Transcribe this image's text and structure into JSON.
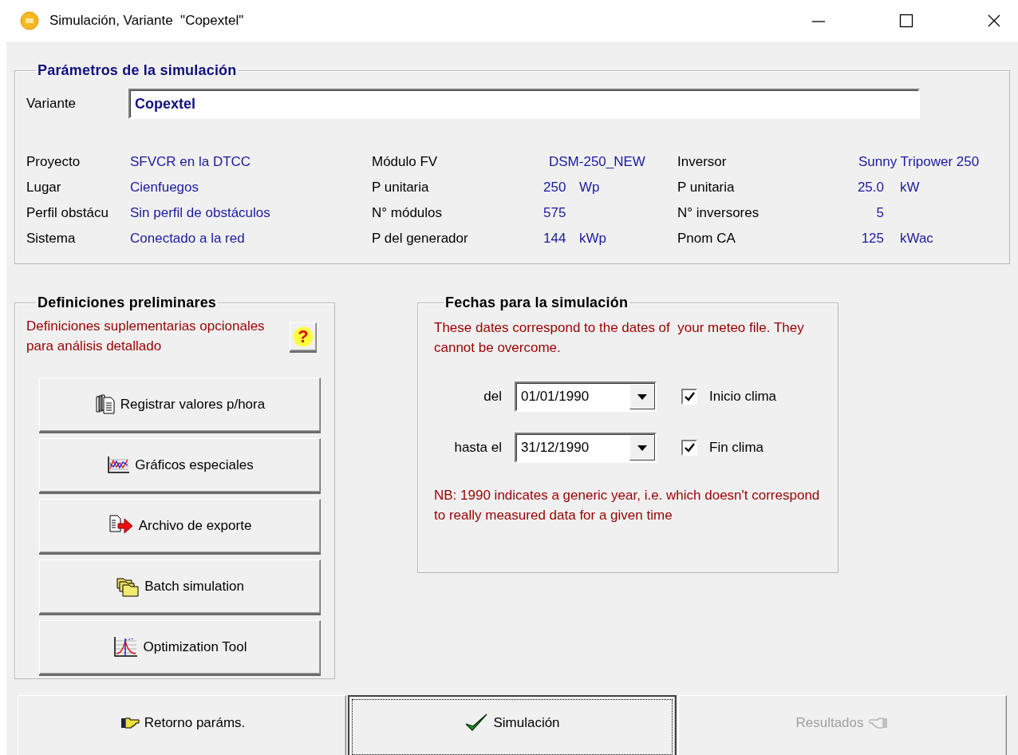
{
  "window": {
    "title": "Simulación, Variante  \"Copextel\""
  },
  "parameters": {
    "title": "Parámetros de la simulación",
    "variant": {
      "label": "Variante",
      "value": "Copextel"
    },
    "columns": [
      {
        "items": [
          {
            "label": "Proyecto",
            "kind": "text",
            "value": "SFVCR en la DTCC"
          },
          {
            "label": "Lugar",
            "kind": "text",
            "value": "Cienfuegos"
          },
          {
            "label": "Perfil obstácu",
            "kind": "text",
            "value": "Sin perfil de obstáculos"
          },
          {
            "label": "Sistema",
            "kind": "text",
            "value": "Conectado a la red"
          }
        ]
      },
      {
        "items": [
          {
            "label": "Módulo FV",
            "kind": "text",
            "value": "DSM-250_NEW"
          },
          {
            "label": "P unitaria",
            "kind": "quantity",
            "value": "250",
            "unit": "Wp"
          },
          {
            "label": "N° módulos",
            "kind": "quantity",
            "value": "575"
          },
          {
            "label": "P del generador",
            "kind": "quantity",
            "value": "144",
            "unit": "kWp"
          }
        ]
      },
      {
        "items": [
          {
            "label": "Inversor",
            "kind": "text",
            "value": "Sunny Tripower 250"
          },
          {
            "label": "P unitaria",
            "kind": "quantity",
            "value": "25.0",
            "unit": "kW"
          },
          {
            "label": "N° inversores",
            "kind": "quantity",
            "value": "5"
          },
          {
            "label": "Pnom CA",
            "kind": "quantity",
            "value": "125",
            "unit": "kWac"
          }
        ]
      }
    ]
  },
  "preliminary": {
    "title": "Definiciones preliminares",
    "note": "Definiciones suplementarias opcionales para análisis detallado",
    "help_button": {
      "label": "?"
    },
    "buttons": [
      {
        "label": "Registrar valores p/hora"
      },
      {
        "label": "Gráficos especiales"
      },
      {
        "label": "Archivo de exporte"
      },
      {
        "label": "Batch simulation"
      },
      {
        "label": "Optimization Tool"
      }
    ]
  },
  "dates": {
    "title": "Fechas para la simulación",
    "note": "These dates correspond to the dates of  your meteo file. They cannot be overcome.",
    "ranges": [
      {
        "label": "del",
        "value": "01/01/1990",
        "checkbox": "Inicio clima",
        "checked": true
      },
      {
        "label": "hasta el",
        "value": "31/12/1990",
        "checkbox": "Fin clima",
        "checked": true
      }
    ],
    "footnote": "NB: 1990 indicates a generic year, i.e. which doesn't correspond to really measured data for a given time"
  },
  "actions": [
    {
      "label": "Retorno paráms.",
      "focused": false,
      "disabled": false
    },
    {
      "label": "Simulación",
      "focused": true,
      "disabled": false
    },
    {
      "label": "Resultados",
      "focused": false,
      "disabled": true
    }
  ]
}
